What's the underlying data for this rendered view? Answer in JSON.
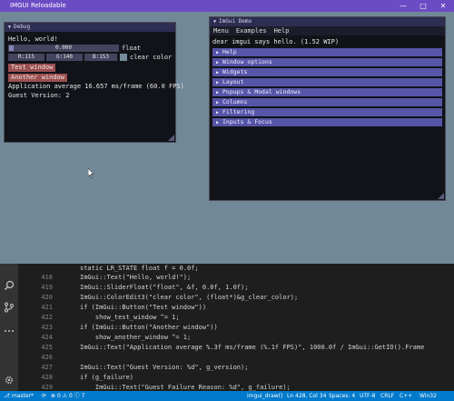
{
  "app": {
    "title": "IMGUI Reloadable",
    "minimize": "—",
    "maximize": "□",
    "close": "✕"
  },
  "debug_window": {
    "title": "Debug",
    "hello": "Hello, world!",
    "slider_value": "0.000",
    "slider_label": "float",
    "color_r": "R:115",
    "color_g": "G:140",
    "color_b": "B:153",
    "color_label": "clear color",
    "swatch_color": "#738c99",
    "btn_test": "Test window",
    "btn_another": "Another window",
    "perf": "Application average 16.657 ms/frame (60.0 FPS)",
    "guest_version": "Guest Version: 2"
  },
  "demo_window": {
    "title": "ImGui Demo",
    "menu": [
      "Menu",
      "Examples",
      "Help"
    ],
    "greeting": "dear imgui says hello. (1.52 WIP)",
    "headers": [
      "Help",
      "Window options",
      "Widgets",
      "Layout",
      "Popups & Modal windows",
      "Columns",
      "Filtering",
      "Inputs & Focus"
    ]
  },
  "editor": {
    "line_numbers": [
      "418",
      "419",
      "420",
      "421",
      "422",
      "423",
      "424",
      "425",
      "426",
      "427",
      "428",
      "429"
    ],
    "lines": [
      "static LR_STATE float f = 0.0f;",
      "ImGui::Text(\"Hello, world!\");",
      "ImGui::SliderFloat(\"float\", &f, 0.0f, 1.0f);",
      "ImGui::ColorEdit3(\"clear color\", (float*)&g_clear_color);",
      "if (ImGui::Button(\"Test window\"))",
      "    show_test_window ^= 1;",
      "if (ImGui::Button(\"Another window\"))",
      "    show_another_window ^= 1;",
      "ImGui::Text(\"Application average %.3f ms/frame (%.1f FPS)\", 1000.0f / ImGui::GetIO().Frame",
      "",
      "ImGui::Text(\"Guest Version: %d\", g_version);",
      "if (g_failure)",
      "    ImGui::Text(\"Guest Failure Reason: %d\", g_failure);",
      "}"
    ]
  },
  "statusbar": {
    "branch": "master*",
    "sync": "⟳",
    "errors": "0",
    "warnings": "0",
    "info": "7",
    "function": "imgui_draw()",
    "position": "Ln 428, Col 34",
    "spaces": "Spaces: 4",
    "encoding": "UTF-8",
    "eol": "CRLF",
    "language": "C++",
    "platform": "Win32"
  }
}
